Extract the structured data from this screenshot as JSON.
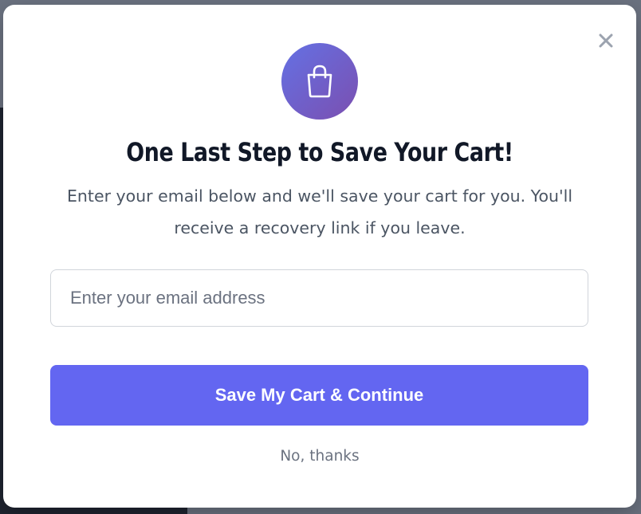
{
  "modal": {
    "title": "One Last Step to Save Your Cart!",
    "subtitle": "Enter your email below and we'll save your cart for you. You'll receive a recovery link if you leave.",
    "email_placeholder": "Enter your email address",
    "email_value": "",
    "save_button_label": "Save My Cart & Continue",
    "decline_label": "No, thanks",
    "icons": {
      "close": "close-icon",
      "bag": "shopping-bag-icon"
    },
    "colors": {
      "accent": "#6366f1",
      "icon_gradient_start": "#6471e4",
      "icon_gradient_end": "#7b4fb0",
      "title": "#111827",
      "muted": "#6b7280"
    }
  }
}
